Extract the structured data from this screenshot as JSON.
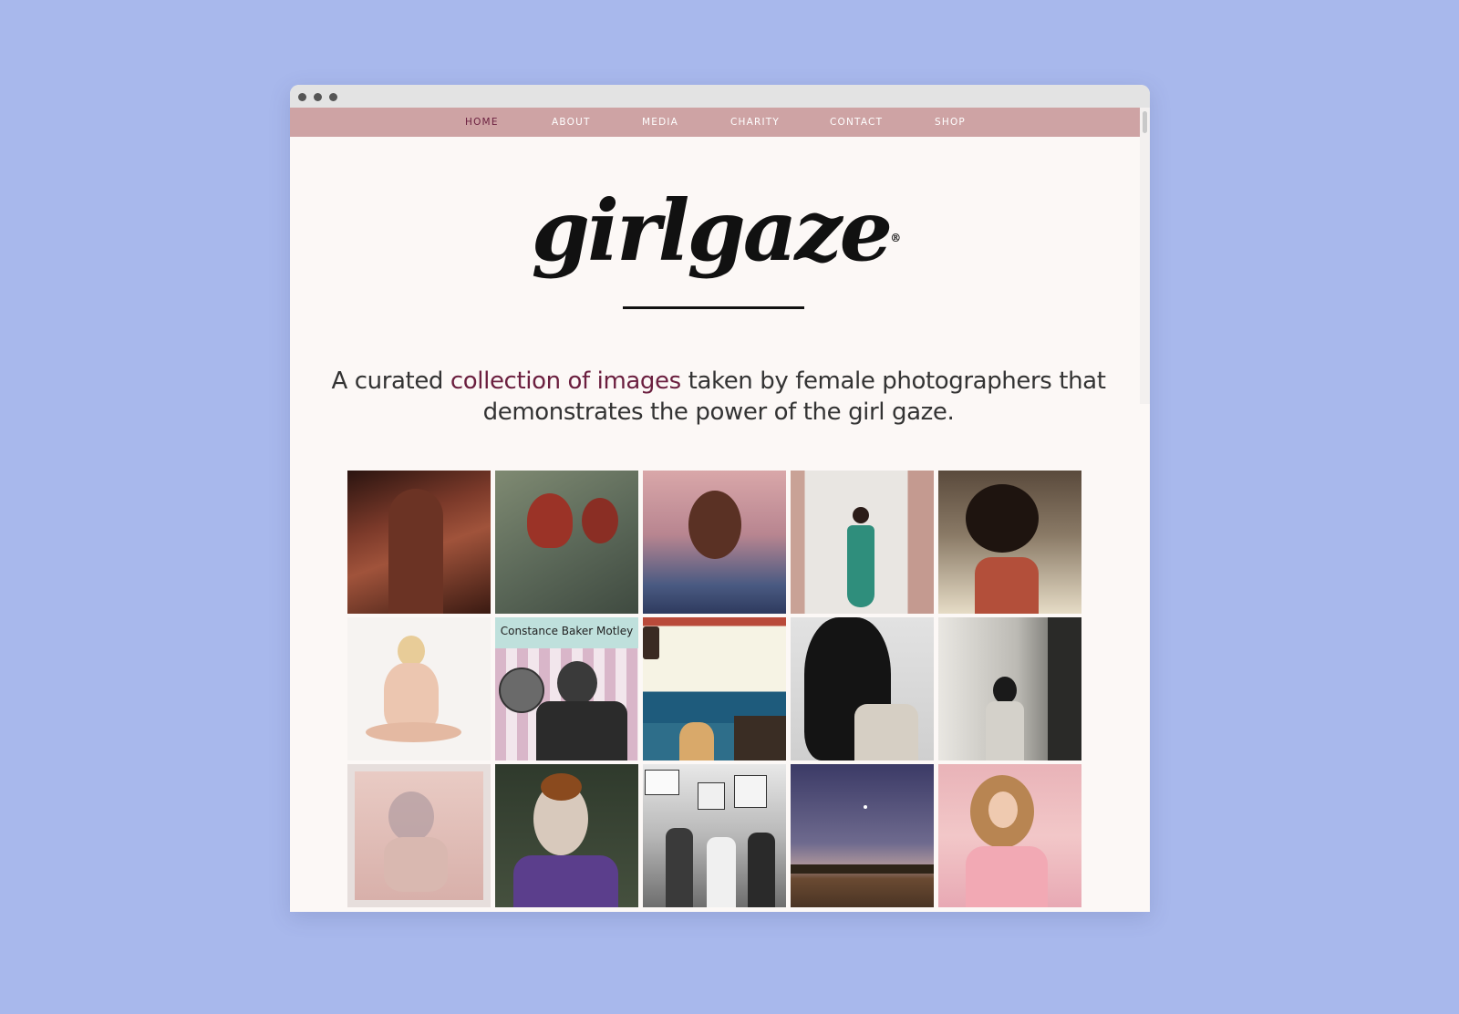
{
  "nav": {
    "items": [
      {
        "label": "HOME",
        "active": true
      },
      {
        "label": "ABOUT",
        "active": false
      },
      {
        "label": "MEDIA",
        "active": false
      },
      {
        "label": "CHARITY",
        "active": false
      },
      {
        "label": "CONTACT",
        "active": false
      },
      {
        "label": "SHOP",
        "active": false
      }
    ]
  },
  "brand": {
    "logo_text": "girlgaze",
    "registered": "®"
  },
  "tagline": {
    "part1": "A curated ",
    "highlight": "collection of images",
    "part2": " taken by female photographers that demonstrates the power of the girl gaze."
  },
  "gallery": {
    "images": [
      {
        "name": "portrait-shirtless-man",
        "label": ""
      },
      {
        "name": "red-tulips",
        "label": ""
      },
      {
        "name": "woman-closeup-pink",
        "label": ""
      },
      {
        "name": "woman-teal-skirt-wall",
        "label": ""
      },
      {
        "name": "woman-afro-window",
        "label": ""
      },
      {
        "name": "woman-sitting-white",
        "label": ""
      },
      {
        "name": "constance-baker-motley",
        "label": "Constance Baker Motley"
      },
      {
        "name": "film-strip-ocean",
        "label": ""
      },
      {
        "name": "woman-curly-hair-bw",
        "label": ""
      },
      {
        "name": "woman-forest-bw",
        "label": ""
      },
      {
        "name": "polaroid-blur-woman",
        "label": ""
      },
      {
        "name": "woman-butterflies",
        "label": ""
      },
      {
        "name": "freedom-march-bw",
        "label": ""
      },
      {
        "name": "desert-night-sky",
        "label": ""
      },
      {
        "name": "woman-pink-dress",
        "label": ""
      }
    ]
  },
  "colors": {
    "background": "#a8b8ec",
    "navbar": "#cea3a4",
    "accent": "#6b1f3f",
    "page": "#fcf8f6"
  }
}
